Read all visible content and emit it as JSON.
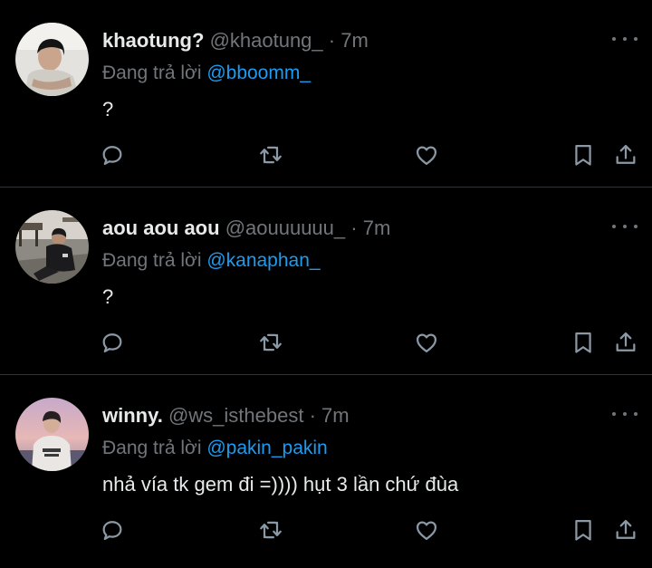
{
  "tweets": [
    {
      "name": "khaotung?",
      "handle": "@khaotung_",
      "separator": "·",
      "time": "7m",
      "reply_prefix": "Đang trả lời",
      "reply_to": "@bboomm_",
      "text": "?",
      "avatar": "avatar-khaotung"
    },
    {
      "name": "aou aou aou",
      "handle": "@aouuuuuu_",
      "separator": "·",
      "time": "7m",
      "reply_prefix": "Đang trả lời",
      "reply_to": "@kanaphan_",
      "text": "?",
      "avatar": "avatar-aouaouaou"
    },
    {
      "name": "winny.",
      "handle": "@ws_isthebest",
      "separator": "·",
      "time": "7m",
      "reply_prefix": "Đang trả lời",
      "reply_to": "@pakin_pakin",
      "text": "nhả vía tk gem đi =)))) hụt 3 lần chứ đùa",
      "avatar": "avatar-winny"
    }
  ],
  "icons": {
    "more": "more-icon",
    "reply": "reply-icon",
    "retweet": "retweet-icon",
    "like": "heart-icon",
    "bookmark": "bookmark-icon",
    "share": "share-icon"
  },
  "colors": {
    "background": "#000000",
    "text": "#e7e9ea",
    "secondary": "#71767b",
    "mention": "#1d9bf0",
    "divider": "#2f3336"
  }
}
